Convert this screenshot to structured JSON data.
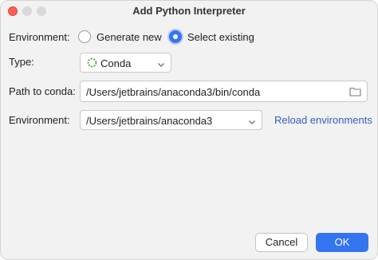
{
  "window": {
    "title": "Add Python Interpreter"
  },
  "environment_mode": {
    "label": "Environment:",
    "options": [
      {
        "label": "Generate new",
        "selected": false
      },
      {
        "label": "Select existing",
        "selected": true
      }
    ]
  },
  "type": {
    "label": "Type:",
    "value": "Conda",
    "icon": "conda-icon"
  },
  "path": {
    "label": "Path to conda:",
    "value": "/Users/jetbrains/anaconda3/bin/conda",
    "icon": "folder-icon"
  },
  "environment": {
    "label": "Environment:",
    "value": "/Users/jetbrains/anaconda3",
    "reload_label": "Reload environments"
  },
  "buttons": {
    "cancel": "Cancel",
    "ok": "OK"
  },
  "colors": {
    "accent": "#3574f0",
    "link": "#2f5fc1",
    "close": "#fe5f57"
  }
}
